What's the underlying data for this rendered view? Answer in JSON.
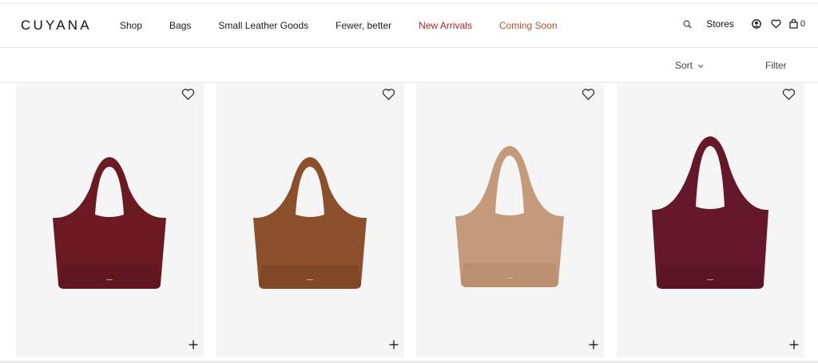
{
  "brand": {
    "logo": "CUYANA"
  },
  "nav": {
    "items": [
      {
        "label": "Shop"
      },
      {
        "label": "Bags"
      },
      {
        "label": "Small Leather Goods"
      },
      {
        "label": "Fewer, better"
      },
      {
        "label": "New Arrivals"
      },
      {
        "label": "Coming Soon"
      }
    ]
  },
  "tools": {
    "search_icon": "search-icon",
    "stores_label": "Stores",
    "account_icon": "account-icon",
    "wishlist_icon": "heart-icon",
    "cart_icon": "bag-icon",
    "cart_count": "0"
  },
  "toolbar": {
    "sort_label": "Sort",
    "filter_label": "Filter"
  },
  "products": [
    {
      "color_name": "burgundy",
      "color": "#6b1a22",
      "color_dark": "#4e1218"
    },
    {
      "color_name": "brown",
      "color": "#8c4f2c",
      "color_dark": "#6a3a1f"
    },
    {
      "color_name": "tan",
      "color": "#c59a7a",
      "color_dark": "#a77f62"
    },
    {
      "color_name": "burgundy",
      "color": "#64182a",
      "color_dark": "#45101c"
    }
  ],
  "colors": {
    "accent_red": "#a4262c",
    "accent_orange": "#b5502a",
    "card_bg": "#f5f5f5"
  }
}
